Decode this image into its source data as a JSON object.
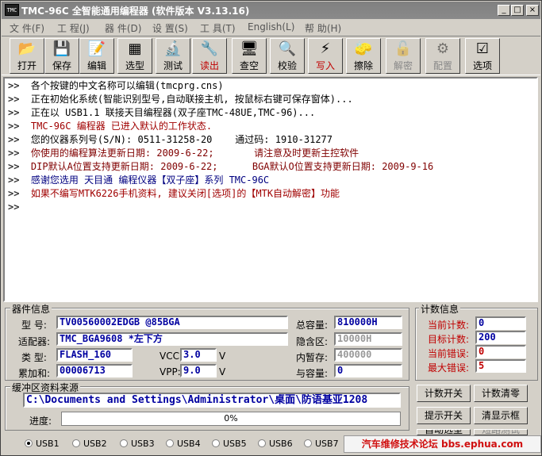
{
  "window": {
    "app_icon_text": "TMC",
    "title": "TMC-96C 全智能通用编程器 (软件版本 V3.13.16)",
    "min_glyph": "_",
    "max_glyph": "□",
    "close_glyph": "×"
  },
  "menu": [
    "文 件(F)",
    "工 程(J)",
    "器 件(D)",
    "设 置(S)",
    "工 具(T)",
    "English(L)",
    "帮 助(H)"
  ],
  "toolbar": [
    {
      "label": "打开",
      "icon": "open-folder-icon",
      "glyph": "📂",
      "enabled": true
    },
    {
      "label": "保存",
      "icon": "save-disk-icon",
      "glyph": "💾",
      "enabled": true
    },
    {
      "label": "编辑",
      "icon": "edit-icon",
      "glyph": "📝",
      "enabled": true
    },
    {
      "label": "选型",
      "icon": "chip-icon",
      "glyph": "▦",
      "enabled": true
    },
    {
      "label": "测试",
      "icon": "test-chip-icon",
      "glyph": "🔬",
      "enabled": true
    },
    {
      "label": "读出",
      "icon": "read-icon",
      "glyph": "🔧",
      "enabled": true,
      "color": "#c00000"
    },
    {
      "label": "查空",
      "icon": "blank-check-icon",
      "glyph": "🖥",
      "enabled": true
    },
    {
      "label": "校验",
      "icon": "verify-icon",
      "glyph": "🔍",
      "enabled": true
    },
    {
      "label": "写入",
      "icon": "write-lightning-icon",
      "glyph": "⚡",
      "enabled": true,
      "color": "#c00000"
    },
    {
      "label": "擦除",
      "icon": "erase-icon",
      "glyph": "🧽",
      "enabled": true
    },
    {
      "label": "解密",
      "icon": "decrypt-icon",
      "glyph": "🔓",
      "enabled": false
    },
    {
      "label": "配置",
      "icon": "config-icon",
      "glyph": "⚙",
      "enabled": false
    },
    {
      "label": "选项",
      "icon": "options-checklist-icon",
      "glyph": "☑",
      "enabled": true
    }
  ],
  "log": [
    {
      "prefix": ">>",
      "text": "  各个按键的中文名称可以编辑(tmcprg.cns)",
      "color": "#000000"
    },
    {
      "prefix": ">>",
      "text": "  正在初始化系统(智能识别型号,自动联接主机, 按鼠标右键可保存窗体)...",
      "color": "#000000"
    },
    {
      "prefix": ">>",
      "text": "  正在以 USB1.1 联接天目编程器(双子座TMC-48UE,TMC-96)...",
      "color": "#000000"
    },
    {
      "prefix": ">>",
      "text": "  TMC-96C 编程器 已进入默认的工作状态.",
      "color": "#a00000"
    },
    {
      "prefix": ">>",
      "text": "  您的仪器系列号(S/N): 0511-31258-20    通过码: 1910-31277",
      "color": "#000000"
    },
    {
      "prefix": ">>",
      "text": "  你使用的编程算法更新日期: 2009-6-22;       请注意及时更新主控软件",
      "color": "#800000"
    },
    {
      "prefix": ">>",
      "text": "  DIP默认A位置支持更新日期: 2009-6-22;      BGA默认O位置支持更新日期: 2009-9-16",
      "color": "#800000"
    },
    {
      "prefix": ">>",
      "text": "  感谢您选用 天目通 编程仪器【双子座】系列 TMC-96C",
      "color": "#000080"
    },
    {
      "prefix": ">>",
      "text": "  如果不编写MTK6226手机资料, 建议关闭[选项]的【MTK自动解密】功能",
      "color": "#a00000"
    },
    {
      "prefix": ">>",
      "text": "",
      "color": "#000000"
    }
  ],
  "device": {
    "legend": "器件信息",
    "model_label": "型 号:",
    "model": "TV00560002EDGB @85BGA",
    "adapter_label": "适配器:",
    "adapter": "TMC_BGA9608 *左下方",
    "type_label": "类 型:",
    "type": "FLASH_160",
    "checksum_label": "累加和:",
    "checksum": "00006713",
    "vcc_label": "VCC:",
    "vcc": "3.0",
    "vcc_unit": "V",
    "vpp_label": "VPP:",
    "vpp": "9.0",
    "vpp_unit": "V",
    "total_label": "总容量:",
    "total": "810000H",
    "hidden_label": "隐含区:",
    "hidden": "10000H",
    "mem_label": "内暂存:",
    "mem": "400000",
    "extra_label": "与容量:",
    "extra": "0"
  },
  "counter": {
    "legend": "计数信息",
    "current_label": "当前计数:",
    "current": "0",
    "target_label": "目标计数:",
    "target": "200",
    "err_label": "当前错误:",
    "err": "0",
    "maxerr_label": "最大错误:",
    "maxerr": "5"
  },
  "buffer": {
    "legend": "缓冲区资料来源",
    "path": "C:\\Documents and Settings\\Administrator\\桌面\\防语基亚1208",
    "progress_label": "进度:",
    "progress_text": "0%",
    "progress": 0
  },
  "buttons": [
    "计数开关",
    "计数清零",
    "提示开关",
    "清显示框",
    "自动选型",
    "短路测试"
  ],
  "usb": {
    "selected": "USB1",
    "options": [
      "USB1",
      "USB2",
      "USB3",
      "USB4",
      "USB5",
      "USB6",
      "USB7"
    ]
  },
  "watermark": "汽车维修技术论坛 bbs.ephua.com"
}
